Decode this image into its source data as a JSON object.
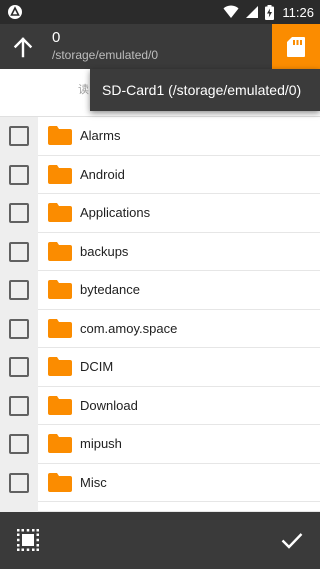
{
  "status_bar": {
    "time": "11:26",
    "icons": [
      "app-notification-icon",
      "wifi-icon",
      "signal-icon",
      "battery-charging-icon"
    ]
  },
  "app_bar": {
    "title": "0",
    "path": "/storage/emulated/0",
    "up_icon": "arrow-up-icon",
    "storage_icon": "sd-card-icon",
    "accent_color": "#fb8c00"
  },
  "hint": {
    "text": "读"
  },
  "storage_menu": {
    "items": [
      "SD-Card1 (/storage/emulated/0)"
    ]
  },
  "folders": [
    {
      "name": "Alarms"
    },
    {
      "name": "Android"
    },
    {
      "name": "Applications"
    },
    {
      "name": "backups"
    },
    {
      "name": "bytedance"
    },
    {
      "name": "com.amoy.space"
    },
    {
      "name": "DCIM"
    },
    {
      "name": "Download"
    },
    {
      "name": "mipush"
    },
    {
      "name": "Misc"
    }
  ],
  "bottom_bar": {
    "select_all_icon": "select-all-icon",
    "confirm_icon": "checkmark-icon"
  }
}
